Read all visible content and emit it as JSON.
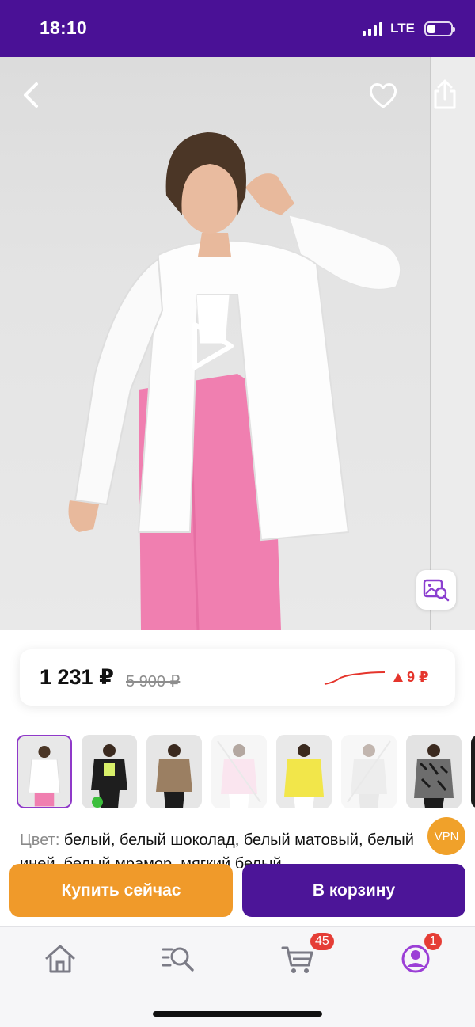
{
  "status_bar": {
    "time": "18:10",
    "network": "LTE",
    "battery_level": 0.3
  },
  "hero": {
    "back_icon": "chevron-left-icon",
    "favorite_icon": "heart-icon",
    "share_icon": "share-icon",
    "play_icon": "play-icon",
    "visual_search_icon": "image-search-icon"
  },
  "price": {
    "current": "1 231 ₽",
    "old": "5 900 ₽",
    "change": "9 ₽",
    "change_color": "#e5352c"
  },
  "thumbnails": [
    {
      "id": 1,
      "selected": true,
      "available": true
    },
    {
      "id": 2,
      "selected": false,
      "available": true
    },
    {
      "id": 3,
      "selected": false,
      "available": true
    },
    {
      "id": 4,
      "selected": false,
      "available": false
    },
    {
      "id": 5,
      "selected": false,
      "available": true
    },
    {
      "id": 6,
      "selected": false,
      "available": false
    },
    {
      "id": 7,
      "selected": false,
      "available": true
    }
  ],
  "color": {
    "label": "Цвет:",
    "value": " белый, белый шоколад, белый матовый, белый иней, белый мрамор, мягкий белый"
  },
  "vpn_badge": "VPN",
  "actions": {
    "buy_now": "Купить сейчас",
    "add_to_cart": "В корзину"
  },
  "nav": {
    "home_icon": "home-icon",
    "catalog_icon": "catalog-search-icon",
    "cart_icon": "cart-icon",
    "profile_icon": "profile-icon",
    "cart_badge": "45",
    "profile_badge": "1"
  },
  "colors": {
    "brand_purple": "#4c1598",
    "accent_orange": "#f09a2a",
    "badge_red": "#e53d36"
  }
}
